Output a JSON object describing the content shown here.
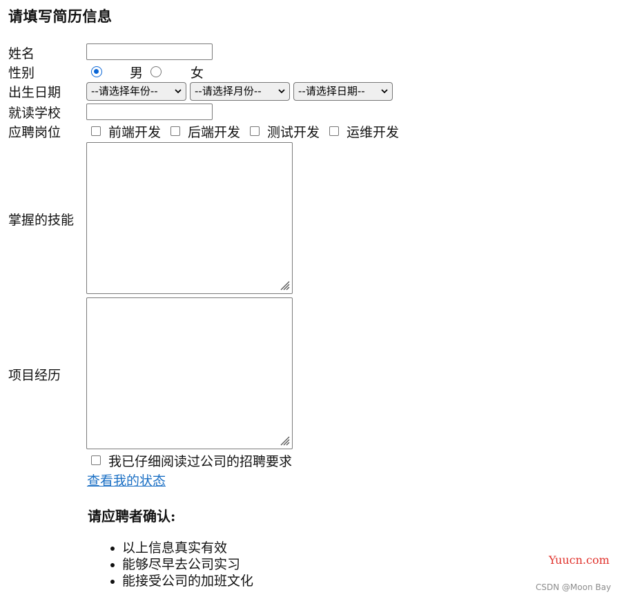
{
  "form": {
    "title": "请填写简历信息",
    "name_label": "姓名",
    "name_value": "",
    "gender_label": "性别",
    "gender_options": [
      {
        "label": "男",
        "checked": true
      },
      {
        "label": "女",
        "checked": false
      }
    ],
    "birth_label": "出生日期",
    "birth_selects": [
      {
        "selected": "--请选择年份--"
      },
      {
        "selected": "--请选择月份--"
      },
      {
        "selected": "--请选择日期--"
      }
    ],
    "school_label": "就读学校",
    "school_value": "",
    "position_label": "应聘岗位",
    "positions": [
      {
        "label": "前端开发",
        "checked": false
      },
      {
        "label": "后端开发",
        "checked": false
      },
      {
        "label": "测试开发",
        "checked": false
      },
      {
        "label": "运维开发",
        "checked": false
      }
    ],
    "skills_label": "掌握的技能",
    "skills_value": "",
    "project_label": "项目经历",
    "project_value": "",
    "agreement_label": "我已仔细阅读过公司的招聘要求",
    "agreement_checked": false,
    "status_link": "查看我的状态"
  },
  "confirm": {
    "heading": "请应聘者确认:",
    "items": [
      "以上信息真实有效",
      "能够尽早去公司实习",
      "能接受公司的加班文化"
    ]
  },
  "watermarks": {
    "site": "Yuucn.com",
    "csdn": "CSDN @Moon Bay"
  },
  "colors": {
    "accent": "#0a66d6",
    "link": "#1a6fc4",
    "watermark_red": "#e0302a"
  }
}
